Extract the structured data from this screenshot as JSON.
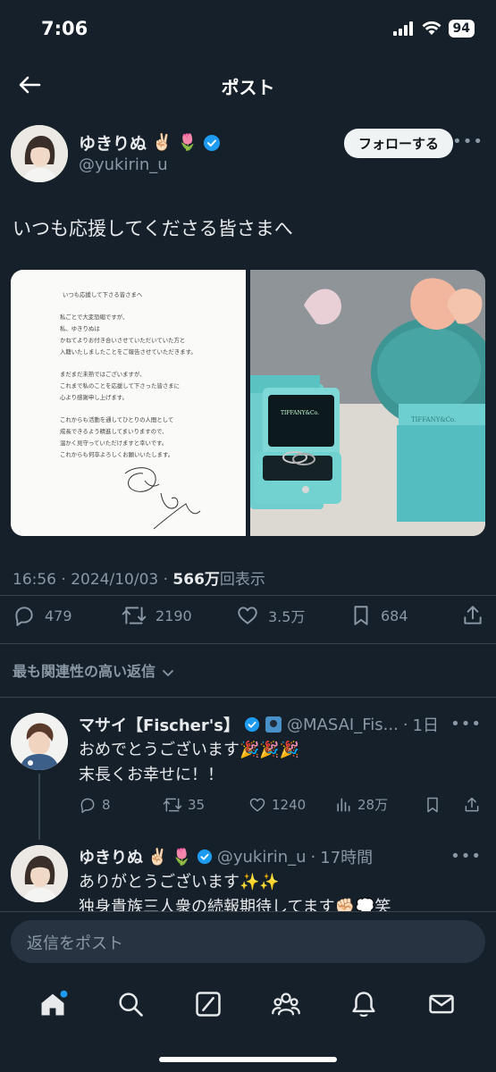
{
  "status_bar": {
    "time": "7:06",
    "battery": "94"
  },
  "header": {
    "title": "ポスト"
  },
  "author": {
    "name": "ゆきりぬ",
    "handle": "@yukirin_u",
    "follow_label": "フォローする"
  },
  "post": {
    "text": "いつも応援してくださる皆さまへ",
    "letter_lines": [
      "いつも応援して下さる皆さまへ",
      "私ごとで大変恐縮ですが、",
      "私、ゆきりぬは",
      "かねてよりお付き合いさせていただいていた方と",
      "入籍いたしましたことをご報告させていただきます。",
      "まだまだ未熟ではございますが、",
      "これまで私のことを応援して下さった皆さまに",
      "心より感謝申し上げます。",
      "これからも活動を通してひとりの人間として",
      "成長できるよう精進してまいりますので、",
      "温かく見守っていただけますと幸いです。",
      "これからも何卒よろしくお願いいたします。"
    ],
    "box_brand": "TIFFANY&Co.",
    "time": "16:56",
    "date": "2024/10/03",
    "views_value": "566万",
    "views_label": "回表示"
  },
  "actions": {
    "replies": "479",
    "reposts": "2190",
    "likes": "3.5万",
    "bookmarks": "684"
  },
  "sort_label": "最も関連性の高い返信",
  "replies": [
    {
      "name": "マサイ【Fischer's】",
      "handle": "@MASAI_Fis...",
      "time": "1日",
      "lines": [
        "おめでとうございます🎉🎉🎉",
        "末長くお幸せに！！"
      ],
      "stats": {
        "replies": "8",
        "reposts": "35",
        "likes": "1240",
        "views": "28万"
      }
    },
    {
      "name": "ゆきりぬ",
      "handle": "@yukirin_u",
      "time": "17時間",
      "lines": [
        "ありがとうございます✨✨",
        "独身貴族三人衆の続報期待してます✊🏻💭笑"
      ]
    }
  ],
  "compose": {
    "placeholder": "返信をポスト"
  },
  "colors": {
    "background": "#15202b",
    "accent": "#1d9bf0",
    "muted": "#8b98a5",
    "text": "#e7e9ea"
  },
  "icons": [
    "back-arrow-icon",
    "verified-badge-icon",
    "reply-icon",
    "repost-icon",
    "like-icon",
    "bookmark-icon",
    "share-icon",
    "views-icon",
    "home-icon",
    "search-icon",
    "grok-icon",
    "communities-icon",
    "notifications-icon",
    "messages-icon"
  ]
}
